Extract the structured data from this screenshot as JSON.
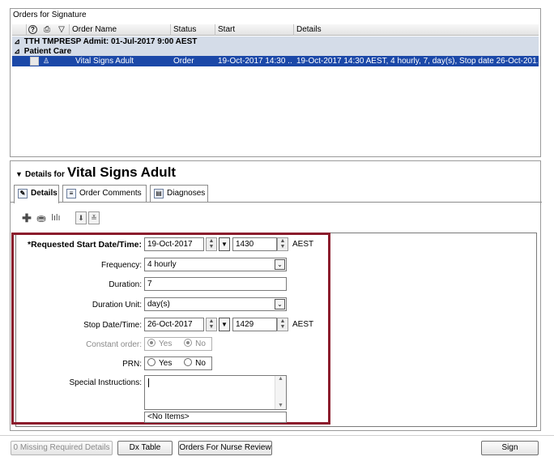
{
  "orders_panel": {
    "title": "Orders for Signature",
    "columns": [
      "Order Name",
      "Status",
      "Start",
      "Details"
    ],
    "header_icons": [
      "help-icon",
      "comment-icon",
      "filter-icon"
    ],
    "group_label": "TTH TMPRESP  Admit: 01-Jul-2017 9:00 AEST",
    "subgroup_label": "Patient Care",
    "order_row": {
      "name": "Vital Signs Adult",
      "status": "Order",
      "start": "19-Oct-2017 14:30 ...",
      "details": "19-Oct-2017 14:30 AEST, 4 hourly, 7, day(s), Stop date 26-Oct-201..."
    },
    "expand_glyph": "⊿"
  },
  "details_panel": {
    "prefix": "Details for",
    "order_title": "Vital Signs Adult",
    "tabs": [
      "Details",
      "Order Comments",
      "Diagnoses"
    ]
  },
  "form": {
    "requested_start_label": "*Requested Start Date/Time:",
    "requested_start_date": "19-Oct-2017",
    "requested_start_time": "1430",
    "timezone": "AEST",
    "frequency_label": "Frequency:",
    "frequency_value": "4 hourly",
    "duration_label": "Duration:",
    "duration_value": "7",
    "duration_unit_label": "Duration Unit:",
    "duration_unit_value": "day(s)",
    "stop_label": "Stop Date/Time:",
    "stop_date": "26-Oct-2017",
    "stop_time": "1429",
    "constant_label": "Constant order:",
    "prn_label": "PRN:",
    "yes": "Yes",
    "no": "No",
    "special_label": "Special Instructions:",
    "no_items": "<No Items>"
  },
  "bottom_bar": {
    "missing": "0 Missing Required Details",
    "dx_table": "Dx Table",
    "nurse_review": "Orders For Nurse Review",
    "sign": "Sign"
  },
  "colors": {
    "selected_row": "#1b48a8",
    "group_row": "#d4dce8",
    "highlight_box": "#8b1c2c"
  }
}
